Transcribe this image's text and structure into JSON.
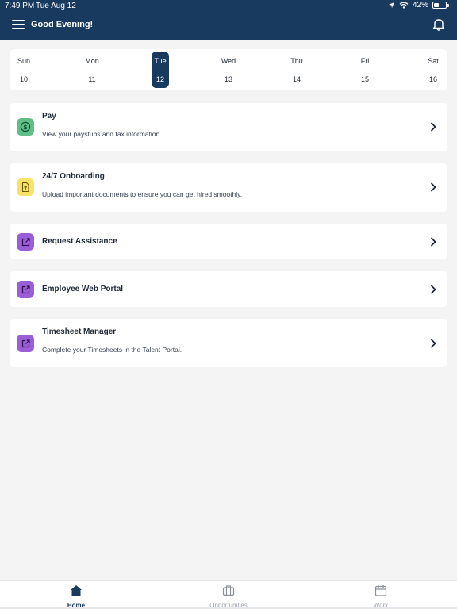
{
  "status_bar": {
    "time": "7:49 PM",
    "date": "Tue Aug 12",
    "battery": "42%",
    "battery_level": 0.42
  },
  "header": {
    "greeting": "Good Evening!",
    "menu_icon": "hamburger-menu-icon",
    "bell_icon": "bell-icon"
  },
  "calendar": {
    "days": [
      {
        "name": "Sun",
        "num": "10"
      },
      {
        "name": "Mon",
        "num": "11"
      },
      {
        "name": "Tue",
        "num": "12",
        "selected": true
      },
      {
        "name": "Wed",
        "num": "13"
      },
      {
        "name": "Thu",
        "num": "14"
      },
      {
        "name": "Fri",
        "num": "15"
      },
      {
        "name": "Sat",
        "num": "16"
      }
    ]
  },
  "cards": [
    {
      "title": "Pay",
      "description": "View your paystubs and tax information.",
      "icon": "dollar-circle-icon",
      "icon_color": "#22a06b",
      "icon_bg": "#5fbf86"
    },
    {
      "title": "24/7 Onboarding",
      "description": "Upload important documents to ensure you can get hired smoothly.",
      "icon": "document-upload-icon",
      "icon_color": "#a18200",
      "icon_bg": "#f7e36a"
    },
    {
      "title": "Request Assistance",
      "icon": "external-link-icon",
      "icon_color": "#4b1d80",
      "icon_bg": "#9b5ed6"
    },
    {
      "title": "Employee Web Portal",
      "icon": "external-link-icon",
      "icon_color": "#4b1d80",
      "icon_bg": "#9b5ed6"
    },
    {
      "title": "Timesheet Manager",
      "description": "Complete your Timesheets in the Talent Portal.",
      "icon": "external-link-icon",
      "icon_color": "#4b1d80",
      "icon_bg": "#9b5ed6"
    }
  ],
  "tabs": [
    {
      "label": "Home",
      "icon": "home-icon",
      "active": true
    },
    {
      "label": "Opportunities",
      "icon": "briefcase-icon"
    },
    {
      "label": "Work",
      "icon": "calendar-icon"
    }
  ],
  "colors": {
    "brand": "#183a5e",
    "inactive": "#9ca3af"
  }
}
